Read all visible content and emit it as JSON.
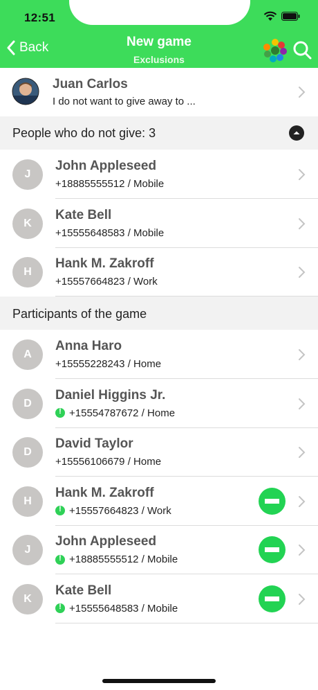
{
  "status_bar": {
    "time": "12:51"
  },
  "nav": {
    "back_label": "Back",
    "title": "New game",
    "subtitle": "Exclusions"
  },
  "owner": {
    "name": "Juan Carlos",
    "note": "I do not want to give away to ..."
  },
  "excluded_section": {
    "title": "People who do not give: 3",
    "items": [
      {
        "initial": "J",
        "name": "John Appleseed",
        "detail": "+18885555512 / Mobile"
      },
      {
        "initial": "K",
        "name": "Kate Bell",
        "detail": "+15555648583 / Mobile"
      },
      {
        "initial": "H",
        "name": "Hank M. Zakroff",
        "detail": "+15557664823 / Work"
      }
    ]
  },
  "participants_section": {
    "title": "Participants of the game",
    "items": [
      {
        "initial": "A",
        "name": "Anna Haro",
        "detail": "+15555228243 / Home",
        "flag": false,
        "excluded": false
      },
      {
        "initial": "D",
        "name": "Daniel Higgins Jr.",
        "detail": "+15554787672 / Home",
        "flag": true,
        "excluded": false
      },
      {
        "initial": "D",
        "name": "David Taylor",
        "detail": "+15556106679 / Home",
        "flag": false,
        "excluded": false
      },
      {
        "initial": "H",
        "name": "Hank M. Zakroff",
        "detail": "+15557664823 / Work",
        "flag": true,
        "excluded": true
      },
      {
        "initial": "J",
        "name": "John Appleseed",
        "detail": "+18885555512 / Mobile",
        "flag": true,
        "excluded": true
      },
      {
        "initial": "K",
        "name": "Kate Bell",
        "detail": "+15555648583 / Mobile",
        "flag": true,
        "excluded": true
      }
    ]
  },
  "colors": {
    "accent": "#3ddc5a",
    "remove_button": "#22d353",
    "avatar_bg": "#c8c6c4",
    "section_bg": "#f2f2f2"
  }
}
